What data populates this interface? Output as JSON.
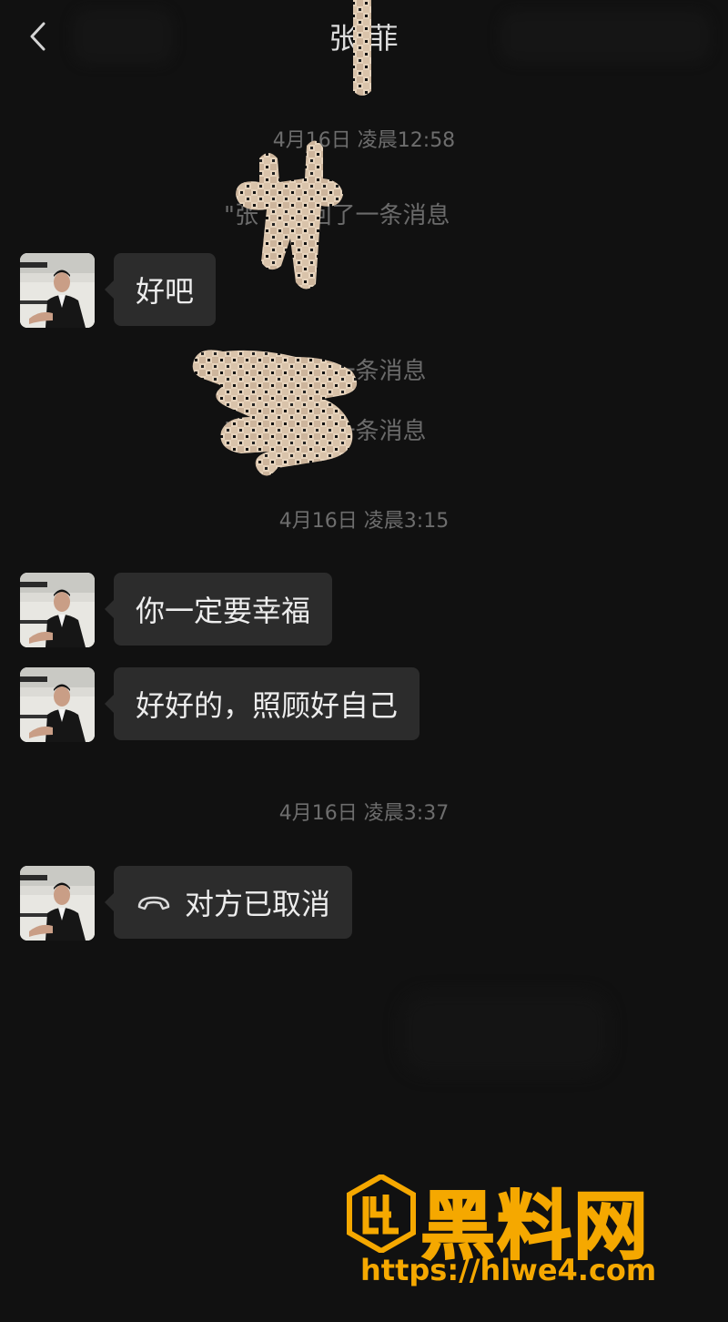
{
  "header": {
    "title": "张 菲",
    "back_icon": "chevron-left-icon"
  },
  "messages": {
    "ts1": "4月16日 凌晨12:58",
    "recall1": "\"张 \" 撤回了一条消息",
    "msg1": "好吧",
    "recall2": "\" \" 撤回了一条消息",
    "recall3": "\" \" 撤回了一条消息",
    "ts2": "4月16日 凌晨3:15",
    "msg2": "你一定要幸福",
    "msg3": "好好的，照顾好自己",
    "ts3": "4月16日 凌晨3:37",
    "call_status": "对方已取消",
    "call_icon": "phone-hangup-icon"
  },
  "watermark": {
    "brand": "黑料网",
    "url": "https://hlwe4.com",
    "color": "#f5a800"
  },
  "colors": {
    "background": "#111111",
    "bubble": "#2c2c2c",
    "pixel_mosaic": "#d8c2a8"
  }
}
